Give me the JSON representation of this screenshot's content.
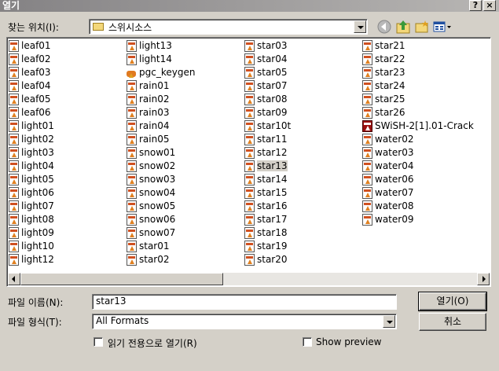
{
  "window": {
    "title": "열기",
    "help_label": "?",
    "close_label": "×"
  },
  "lookin": {
    "label": "찾는 위치(I):",
    "value": "스위시소스"
  },
  "toolbar": {
    "back": "back-icon",
    "up": "up-folder-icon",
    "newfolder": "new-folder-icon",
    "views": "view-menu-icon"
  },
  "files": {
    "col1": [
      "leaf01",
      "leaf02",
      "leaf03",
      "leaf04",
      "leaf05",
      "leaf06",
      "light01",
      "light02",
      "light03",
      "light04",
      "light05",
      "light06",
      "light07",
      "light08",
      "light09",
      "light10",
      "light12"
    ],
    "col2": [
      "light13",
      "light14",
      "pgc_keygen",
      "rain01",
      "rain02",
      "rain03",
      "rain04",
      "rain05",
      "snow01",
      "snow02",
      "snow03",
      "snow04",
      "snow05",
      "snow06",
      "snow07",
      "star01",
      "star02"
    ],
    "col3": [
      "star03",
      "star04",
      "star05",
      "star07",
      "star08",
      "star09",
      "star10t",
      "star11",
      "star12",
      "star13",
      "star14",
      "star15",
      "star16",
      "star17",
      "star18",
      "star19",
      "star20"
    ],
    "col4": [
      "star21",
      "star22",
      "star23",
      "star24",
      "star25",
      "star26",
      "SWiSH-2[1].01-Crack",
      "water02",
      "water03",
      "water04",
      "water06",
      "water07",
      "water08",
      "water09"
    ],
    "selected": "star13"
  },
  "filename": {
    "label": "파일 이름(N):",
    "value": "star13"
  },
  "filetype": {
    "label": "파일 형식(T):",
    "value": "All Formats"
  },
  "buttons": {
    "open": "열기(O)",
    "cancel": "취소"
  },
  "options": {
    "readonly": "읽기 전용으로 열기(R)",
    "preview": "Show preview"
  }
}
